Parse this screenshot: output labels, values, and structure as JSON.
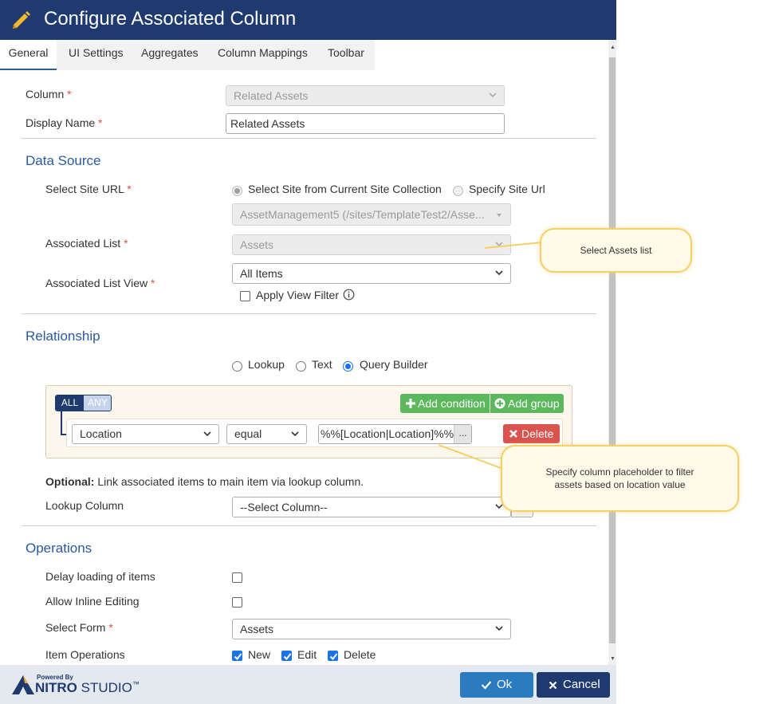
{
  "window": {
    "title": "Configure Associated Column"
  },
  "tabs": [
    {
      "label": "General"
    },
    {
      "label": "UI Settings"
    },
    {
      "label": "Aggregates"
    },
    {
      "label": "Column Mappings"
    },
    {
      "label": "Toolbar"
    }
  ],
  "general": {
    "column": {
      "label": "Column",
      "value": "Related Assets"
    },
    "display_name": {
      "label": "Display Name",
      "value": "Related Assets"
    },
    "required_mark": "*"
  },
  "data_source": {
    "heading": "Data Source",
    "site_url": {
      "label": "Select Site URL",
      "option_current": "Select Site from Current Site Collection",
      "option_specify": "Specify Site Url",
      "site_value": "AssetManagement5 (/sites/TemplateTest2/Asse..."
    },
    "associated_list": {
      "label": "Associated List",
      "value": "Assets"
    },
    "associated_list_view": {
      "label": "Associated List View",
      "value": "All Items"
    },
    "apply_view_filter": {
      "label": "Apply View Filter",
      "checked": false
    }
  },
  "relationship": {
    "heading": "Relationship",
    "modes": [
      "Lookup",
      "Text",
      "Query Builder"
    ],
    "selected_mode": "Query Builder",
    "query": {
      "all_label": "ALL",
      "any_label": "ANY",
      "add_condition": "Add condition",
      "add_group": "Add group",
      "field": "Location",
      "operator": "equal",
      "value": "%%[Location|Location]%%",
      "ellipsis": "...",
      "delete": "Delete"
    },
    "optional_bold": "Optional:",
    "optional_text": " Link associated items to main item via lookup column.",
    "lookup_column": {
      "label": "Lookup Column",
      "value": "--Select Column--"
    }
  },
  "operations": {
    "heading": "Operations",
    "delay_loading": {
      "label": "Delay loading of items",
      "checked": false
    },
    "inline_editing": {
      "label": "Allow Inline Editing",
      "checked": false
    },
    "select_form": {
      "label": "Select Form",
      "value": "Assets"
    },
    "item_operations": {
      "label": "Item Operations",
      "new": "New",
      "edit": "Edit",
      "delete": "Delete"
    }
  },
  "callouts": {
    "assets": "Select Assets list",
    "placeholder_line1": "Specify column placeholder to filter",
    "placeholder_line2": "assets based on location value"
  },
  "footer": {
    "powered_by": "Powered By",
    "brand_nitro": "NITRO",
    "brand_studio": "STUDIO",
    "trademark": "™",
    "ok": "Ok",
    "cancel": "Cancel"
  },
  "colors": {
    "titlebar": "#1f3a6e",
    "accent": "#2a5aa0",
    "success": "#5cb85c",
    "danger": "#d9534f",
    "primary_button": "#2b7bc1",
    "cancel_button": "#1f3a6e"
  }
}
